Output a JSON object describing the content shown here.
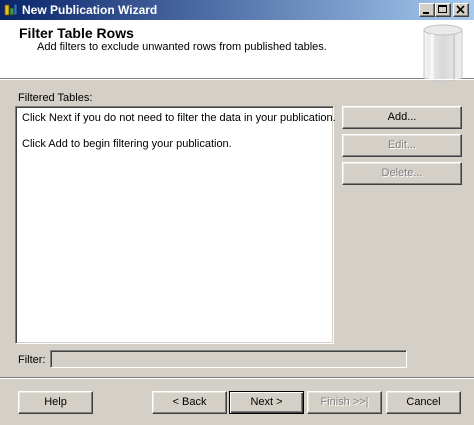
{
  "window": {
    "title": "New Publication Wizard"
  },
  "header": {
    "title": "Filter Table Rows",
    "subtitle": "Add filters to exclude unwanted rows from published tables."
  },
  "filtered_tables": {
    "label": "Filtered Tables:",
    "messages": [
      "Click Next if you do not need to filter the data in your publication.",
      "Click Add to begin filtering your publication."
    ]
  },
  "side_buttons": {
    "add": "Add...",
    "edit": "Edit...",
    "delete": "Delete..."
  },
  "filter": {
    "label": "Filter:",
    "value": ""
  },
  "footer": {
    "help": "Help",
    "back": "< Back",
    "next": "Next >",
    "finish": "Finish >>|",
    "cancel": "Cancel"
  }
}
